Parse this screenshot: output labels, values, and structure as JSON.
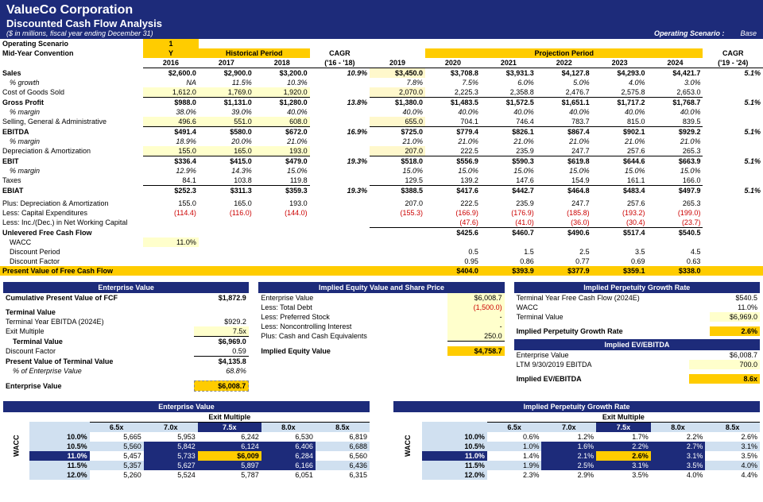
{
  "header": {
    "company": "ValueCo Corporation",
    "title": "Discounted Cash Flow Analysis",
    "units": "($ in millions, fiscal year ending December 31)",
    "scenario_label": "Operating Scenario :",
    "scenario": "Base"
  },
  "top": {
    "os_label": "Operating Scenario",
    "os_val": "1",
    "mid_label": "Mid-Year Convention",
    "mid_val": "Y",
    "hist_period": "Historical Period",
    "proj_period": "Projection Period",
    "cagr_hist": "CAGR",
    "cagr_hist_range": "('16 - '18)",
    "cagr_proj": "CAGR",
    "cagr_proj_range": "('19 - '24)",
    "years": [
      "2016",
      "2017",
      "2018",
      "",
      "2019",
      "2020",
      "2021",
      "2022",
      "2023",
      "2024"
    ]
  },
  "rows": {
    "sales": {
      "l": "Sales",
      "v": [
        "$2,600.0",
        "$2,900.0",
        "$3,200.0",
        "10.9%",
        "$3,450.0",
        "$3,708.8",
        "$3,931.3",
        "$4,127.8",
        "$4,293.0",
        "$4,421.7"
      ],
      "cagr": "5.1%"
    },
    "growth": {
      "l": "% growth",
      "v": [
        "NA",
        "11.5%",
        "10.3%",
        "",
        "7.8%",
        "7.5%",
        "6.0%",
        "5.0%",
        "4.0%",
        "3.0%"
      ]
    },
    "cogs": {
      "l": "Cost of Goods Sold",
      "v": [
        "1,612.0",
        "1,769.0",
        "1,920.0",
        "",
        "2,070.0",
        "2,225.3",
        "2,358.8",
        "2,476.7",
        "2,575.8",
        "2,653.0"
      ]
    },
    "gp": {
      "l": "Gross Profit",
      "v": [
        "$988.0",
        "$1,131.0",
        "$1,280.0",
        "13.8%",
        "$1,380.0",
        "$1,483.5",
        "$1,572.5",
        "$1,651.1",
        "$1,717.2",
        "$1,768.7"
      ],
      "cagr": "5.1%"
    },
    "gpm": {
      "l": "% margin",
      "v": [
        "38.0%",
        "39.0%",
        "40.0%",
        "",
        "40.0%",
        "40.0%",
        "40.0%",
        "40.0%",
        "40.0%",
        "40.0%"
      ]
    },
    "sga": {
      "l": "Selling, General & Administrative",
      "v": [
        "496.6",
        "551.0",
        "608.0",
        "",
        "655.0",
        "704.1",
        "746.4",
        "783.7",
        "815.0",
        "839.5"
      ]
    },
    "ebitda": {
      "l": "EBITDA",
      "v": [
        "$491.4",
        "$580.0",
        "$672.0",
        "16.9%",
        "$725.0",
        "$779.4",
        "$826.1",
        "$867.4",
        "$902.1",
        "$929.2"
      ],
      "cagr": "5.1%"
    },
    "ebitdam": {
      "l": "% margin",
      "v": [
        "18.9%",
        "20.0%",
        "21.0%",
        "",
        "21.0%",
        "21.0%",
        "21.0%",
        "21.0%",
        "21.0%",
        "21.0%"
      ]
    },
    "da": {
      "l": "Depreciation & Amortization",
      "v": [
        "155.0",
        "165.0",
        "193.0",
        "",
        "207.0",
        "222.5",
        "235.9",
        "247.7",
        "257.6",
        "265.3"
      ]
    },
    "ebit": {
      "l": "EBIT",
      "v": [
        "$336.4",
        "$415.0",
        "$479.0",
        "19.3%",
        "$518.0",
        "$556.9",
        "$590.3",
        "$619.8",
        "$644.6",
        "$663.9"
      ],
      "cagr": "5.1%"
    },
    "ebitm": {
      "l": "% margin",
      "v": [
        "12.9%",
        "14.3%",
        "15.0%",
        "",
        "15.0%",
        "15.0%",
        "15.0%",
        "15.0%",
        "15.0%",
        "15.0%"
      ]
    },
    "tax": {
      "l": "Taxes",
      "v": [
        "84.1",
        "103.8",
        "119.8",
        "",
        "129.5",
        "139.2",
        "147.6",
        "154.9",
        "161.1",
        "166.0"
      ]
    },
    "ebiat": {
      "l": "EBIAT",
      "v": [
        "$252.3",
        "$311.3",
        "$359.3",
        "19.3%",
        "$388.5",
        "$417.6",
        "$442.7",
        "$464.8",
        "$483.4",
        "$497.9"
      ],
      "cagr": "5.1%"
    },
    "pda": {
      "l": "Plus: Depreciation & Amortization",
      "v": [
        "155.0",
        "165.0",
        "193.0",
        "",
        "207.0",
        "222.5",
        "235.9",
        "247.7",
        "257.6",
        "265.3"
      ]
    },
    "capex": {
      "l": "Less: Capital Expenditures",
      "v": [
        "(114.4)",
        "(116.0)",
        "(144.0)",
        "",
        "(155.3)",
        "(166.9)",
        "(176.9)",
        "(185.8)",
        "(193.2)",
        "(199.0)"
      ]
    },
    "nwc": {
      "l": "Less: Inc./(Dec.) in Net Working Capital",
      "v": [
        "",
        "",
        "",
        "",
        "",
        "(47.6)",
        "(41.0)",
        "(36.0)",
        "(30.4)",
        "(23.7)"
      ]
    },
    "ufcf": {
      "l": "Unlevered Free Cash Flow",
      "v": [
        "",
        "",
        "",
        "",
        "",
        "$425.6",
        "$460.7",
        "$490.6",
        "$517.4",
        "$540.5"
      ]
    },
    "wacc": {
      "l": "WACC",
      "v": [
        "11.0%"
      ]
    },
    "dp": {
      "l": "Discount Period",
      "v": [
        "",
        "",
        "",
        "",
        "",
        "0.5",
        "1.5",
        "2.5",
        "3.5",
        "4.5"
      ]
    },
    "df": {
      "l": "Discount Factor",
      "v": [
        "",
        "",
        "",
        "",
        "",
        "0.95",
        "0.86",
        "0.77",
        "0.69",
        "0.63"
      ]
    },
    "pvfcf": {
      "l": "Present Value of Free Cash Flow",
      "v": [
        "",
        "",
        "",
        "",
        "",
        "$404.0",
        "$393.9",
        "$377.9",
        "$359.1",
        "$338.0"
      ]
    }
  },
  "ev": {
    "title": "Enterprise Value",
    "cpv_l": "Cumulative Present Value of FCF",
    "cpv_v": "$1,872.9",
    "tv_title": "Terminal Value",
    "te_l": "Terminal Year EBITDA (2024E)",
    "te_v": "$929.2",
    "em_l": "Exit Multiple",
    "em_v": "7.5x",
    "tv_l": "Terminal Value",
    "tv_v": "$6,969.0",
    "df_l": "Discount Factor",
    "df_v": "0.59",
    "pvtv_l": "Present Value of Terminal Value",
    "pvtv_v": "$4,135.8",
    "pct_l": "% of Enterprise Value",
    "pct_v": "68.8%",
    "ent_l": "Enterprise Value",
    "ent_v": "$6,008.7"
  },
  "eq": {
    "title": "Implied Equity Value and Share Price",
    "ev_l": "Enterprise Value",
    "ev_v": "$6,008.7",
    "debt_l": "Less: Total Debt",
    "debt_v": "(1,500.0)",
    "pref_l": "Less: Preferred Stock",
    "pref_v": "-",
    "nci_l": "Less: Noncontrolling Interest",
    "nci_v": "-",
    "cash_l": "Plus: Cash and Cash Equivalents",
    "cash_v": "250.0",
    "iev_l": "Implied Equity Value",
    "iev_v": "$4,758.7"
  },
  "perp": {
    "title": "Implied Perpetuity Growth Rate",
    "tfcf_l": "Terminal Year Free Cash Flow (2024E)",
    "tfcf_v": "$540.5",
    "wacc_l": "WACC",
    "wacc_v": "11.0%",
    "tv_l": "Terminal Value",
    "tv_v": "$6,969.0",
    "ipgr_l": "Implied Perpetuity Growth Rate",
    "ipgr_v": "2.6%",
    "evt": "Implied EV/EBITDA",
    "ev_l": "Enterprise Value",
    "ev_v": "$6,008.7",
    "ltm_l": "LTM 9/30/2019 EBITDA",
    "ltm_v": "700.0",
    "imp_l": "Implied EV/EBITDA",
    "imp_v": "8.6x"
  },
  "sens1": {
    "title": "Enterprise Value",
    "sub": "Exit Multiple",
    "wacc": "WACC",
    "cols": [
      "6.5x",
      "7.0x",
      "7.5x",
      "8.0x",
      "8.5x"
    ],
    "rows": [
      {
        "r": "10.0%",
        "v": [
          "5,665",
          "5,953",
          "6,242",
          "6,530",
          "6,819"
        ]
      },
      {
        "r": "10.5%",
        "v": [
          "5,560",
          "5,842",
          "6,124",
          "6,406",
          "6,688"
        ]
      },
      {
        "r": "11.0%",
        "v": [
          "5,457",
          "5,733",
          "$6,009",
          "6,284",
          "6,560"
        ]
      },
      {
        "r": "11.5%",
        "v": [
          "5,357",
          "5,627",
          "5,897",
          "6,166",
          "6,436"
        ]
      },
      {
        "r": "12.0%",
        "v": [
          "5,260",
          "5,524",
          "5,787",
          "6,051",
          "6,315"
        ]
      }
    ]
  },
  "sens2": {
    "title": "Implied Perpetuity Growth Rate",
    "sub": "Exit Multiple",
    "wacc": "WACC",
    "cols": [
      "6.5x",
      "7.0x",
      "7.5x",
      "8.0x",
      "8.5x"
    ],
    "rows": [
      {
        "r": "10.0%",
        "v": [
          "0.6%",
          "1.2%",
          "1.7%",
          "2.2%",
          "2.6%"
        ]
      },
      {
        "r": "10.5%",
        "v": [
          "1.0%",
          "1.6%",
          "2.2%",
          "2.7%",
          "3.1%"
        ]
      },
      {
        "r": "11.0%",
        "v": [
          "1.4%",
          "2.1%",
          "2.6%",
          "3.1%",
          "3.5%"
        ]
      },
      {
        "r": "11.5%",
        "v": [
          "1.9%",
          "2.5%",
          "3.1%",
          "3.5%",
          "4.0%"
        ]
      },
      {
        "r": "12.0%",
        "v": [
          "2.3%",
          "2.9%",
          "3.5%",
          "4.0%",
          "4.4%"
        ]
      }
    ]
  }
}
